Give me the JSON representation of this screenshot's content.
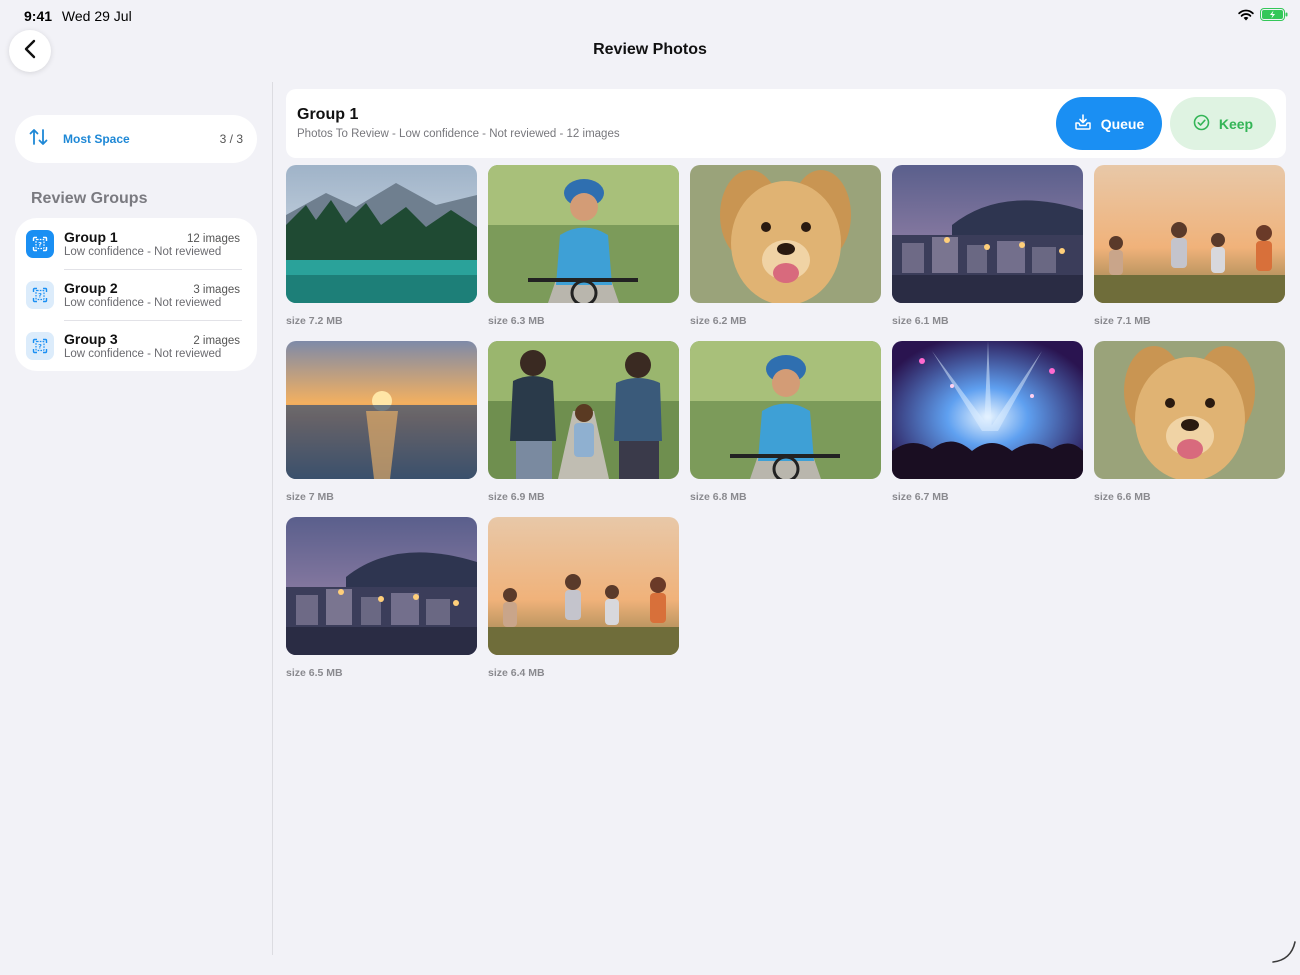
{
  "status": {
    "time": "9:41",
    "date": "Wed 29 Jul"
  },
  "nav": {
    "title": "Review Photos",
    "back_icon": "chevron-left-icon"
  },
  "sidebar": {
    "sort": {
      "label": "Most Space",
      "count": "3 / 3",
      "icon": "sort-arrows-icon"
    },
    "section_title": "Review Groups",
    "groups": [
      {
        "name": "Group 1",
        "count": "12 images",
        "subtitle": "Low confidence - Not reviewed",
        "active": true
      },
      {
        "name": "Group 2",
        "count": "3 images",
        "subtitle": "Low confidence - Not reviewed",
        "active": false
      },
      {
        "name": "Group 3",
        "count": "2 images",
        "subtitle": "Low confidence - Not reviewed",
        "active": false
      }
    ]
  },
  "header": {
    "title": "Group 1",
    "subtitle": "Photos To Review - Low confidence - Not reviewed - 12 images",
    "queue_label": "Queue",
    "keep_label": "Keep",
    "colors": {
      "queue": "#1a8ff3",
      "keep_bg": "#dff3e2",
      "keep_text": "#34b557"
    }
  },
  "photos": [
    {
      "subject": "mountain-lake",
      "size": "size 7.2 MB"
    },
    {
      "subject": "boy-on-bike",
      "size": "size 6.3 MB"
    },
    {
      "subject": "golden-retriever",
      "size": "size 6.2 MB"
    },
    {
      "subject": "harbor-town-evening",
      "size": "size 6.1 MB"
    },
    {
      "subject": "kids-running-sunset",
      "size": "size 7.1 MB"
    },
    {
      "subject": "ocean-sunset",
      "size": "size 7 MB"
    },
    {
      "subject": "family-walking-park",
      "size": "size 6.9 MB"
    },
    {
      "subject": "boy-on-bike",
      "size": "size 6.8 MB"
    },
    {
      "subject": "concert-lights",
      "size": "size 6.7 MB"
    },
    {
      "subject": "golden-retriever",
      "size": "size 6.6 MB"
    },
    {
      "subject": "harbor-town-evening",
      "size": "size 6.5 MB"
    },
    {
      "subject": "kids-running-sunset",
      "size": "size 6.4 MB"
    }
  ]
}
